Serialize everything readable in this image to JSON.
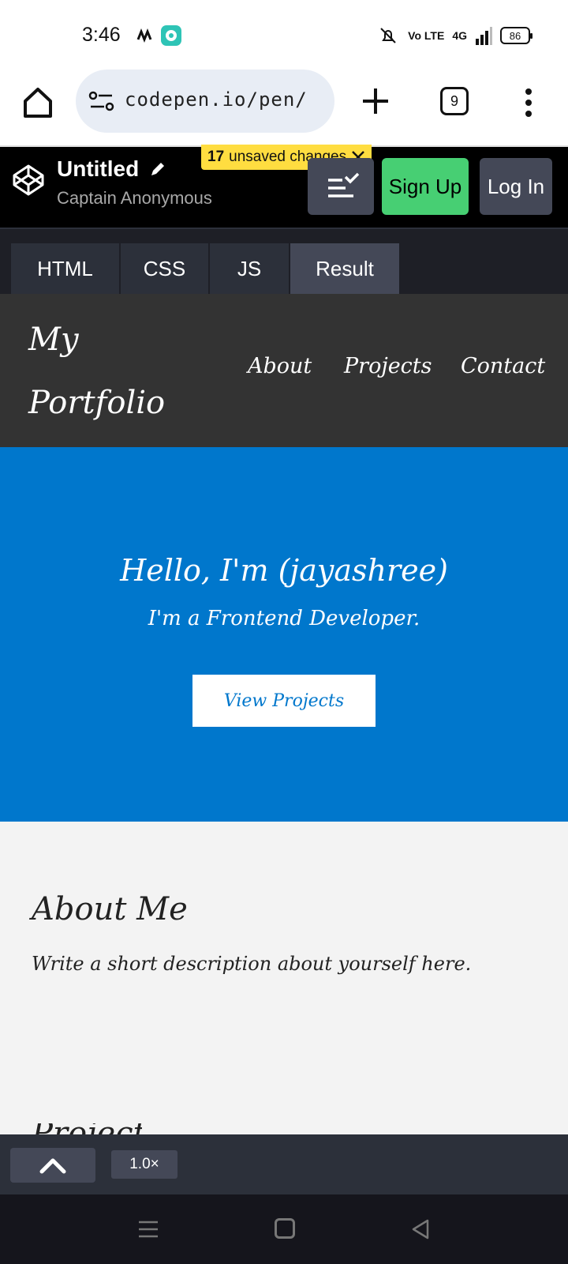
{
  "status_bar": {
    "time": "3:46",
    "network": "4G",
    "volte": "Vo LTE",
    "battery": "86"
  },
  "browser": {
    "url": "codepen.io/pen/",
    "tab_count": "9"
  },
  "codepen": {
    "title": "Untitled",
    "author": "Captain Anonymous",
    "unsaved_count": "17",
    "unsaved_label": "unsaved changes",
    "signup_label": "Sign Up",
    "login_label": "Log In",
    "tabs": [
      {
        "label": "HTML",
        "active": false
      },
      {
        "label": "CSS",
        "active": false
      },
      {
        "label": "JS",
        "active": false
      },
      {
        "label": "Result",
        "active": true
      }
    ],
    "zoom": "1.0×",
    "colors": {
      "header": "#000000",
      "signup": "#47cf73",
      "badge": "#ffdd40",
      "button": "#444857"
    }
  },
  "portfolio": {
    "brand": "My Portfolio",
    "nav": [
      "About",
      "Projects",
      "Contact"
    ],
    "hero_title": "Hello, I'm (jayashree)",
    "hero_subtitle": "I'm a Frontend Developer.",
    "hero_button": "View Projects",
    "about_title": "About Me",
    "about_text": "Write a short description about yourself here.",
    "next_heading": "Projects",
    "colors": {
      "nav_bg": "#333333",
      "hero_bg": "#0077cc",
      "section_bg": "#f3f3f3"
    }
  }
}
